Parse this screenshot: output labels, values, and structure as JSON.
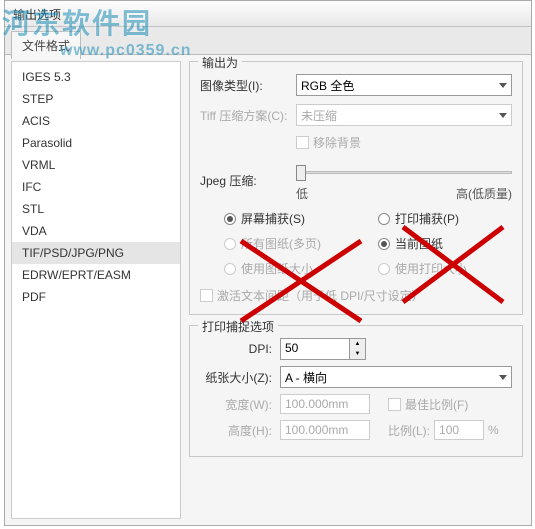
{
  "window": {
    "title": "输出选项",
    "tab": "文件格式"
  },
  "sidebar": {
    "items": [
      "IGES 5.3",
      "STEP",
      "ACIS",
      "Parasolid",
      "VRML",
      "IFC",
      "STL",
      "VDA",
      "TIF/PSD/JPG/PNG",
      "EDRW/EPRT/EASM",
      "PDF"
    ],
    "selected_index": 8
  },
  "output": {
    "group_title": "输出为",
    "image_type_label": "图像类型(I):",
    "image_type_value": "RGB 全色",
    "tiff_compress_label": "Tiff 压缩方案(C):",
    "tiff_compress_value": "未压缩",
    "remove_bg": "移除背景",
    "jpeg_label": "Jpeg 压缩:",
    "jpeg_low": "低",
    "jpeg_high": "高(低质量)",
    "radios": {
      "screen": "屏幕捕获(S)",
      "print": "打印捕获(P)",
      "multi": "所有图纸(多页)",
      "current": "当前图纸",
      "use_draw_size": "使用图纸大小",
      "use_print_size": "使用打印大小"
    },
    "activate_gap": "激活文本间距（用于低 DPI/尺寸设定）"
  },
  "print": {
    "group_title": "打印捕捉选项",
    "dpi_label": "DPI:",
    "dpi_value": "50",
    "paper_label": "纸张大小(Z):",
    "paper_value": "A - 横向",
    "width_label": "宽度(W):",
    "width_value": "100.000mm",
    "height_label": "高度(H):",
    "height_value": "100.000mm",
    "best_ratio": "最佳比例(F)",
    "ratio_label": "比例(L):",
    "ratio_value": "100",
    "pct": "%"
  },
  "watermark": {
    "logo": "河东软件园",
    "url": "www.pc0359.cn"
  }
}
